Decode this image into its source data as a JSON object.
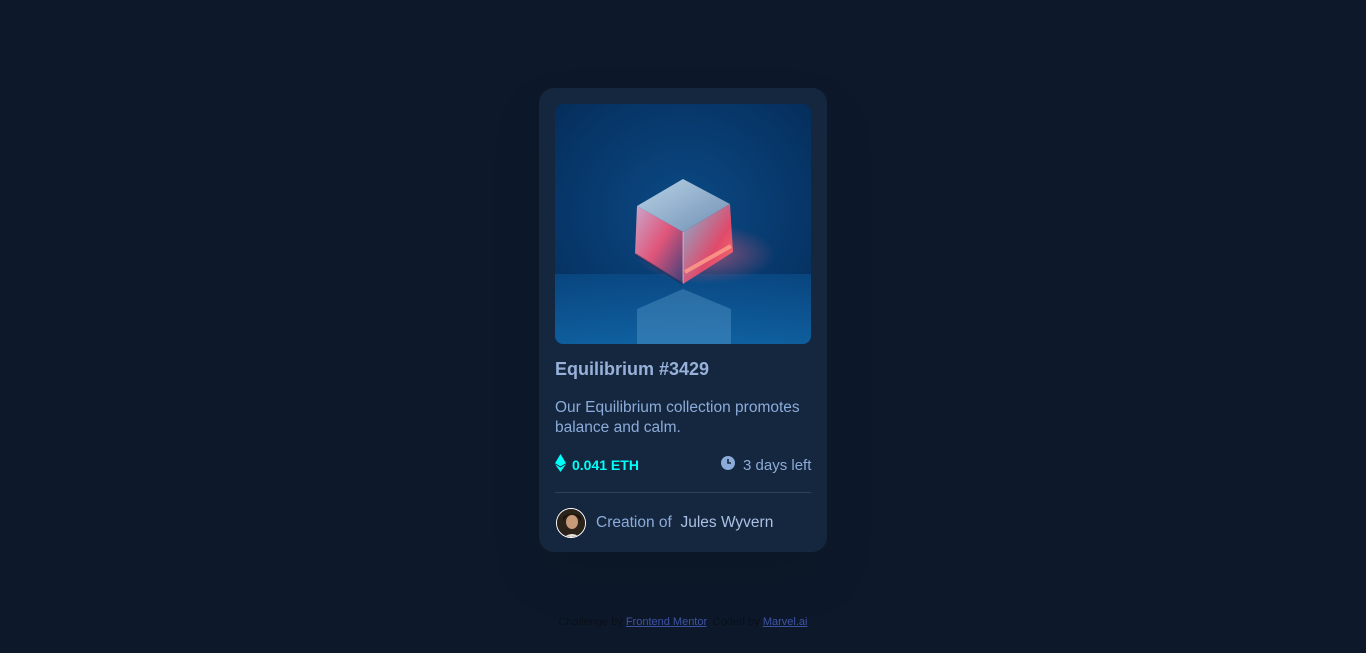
{
  "card": {
    "image_alt": "Equilibrium",
    "title": "Equilibrium #3429",
    "description": "Our Equilibrium collection promotes balance and calm.",
    "price": "0.041 ETH",
    "time_left": "3 days left",
    "creator_prefix": "Creation of",
    "creator_name": "Jules Wyvern",
    "icons": {
      "price": "ethereum-icon",
      "time": "clock-icon"
    }
  },
  "attribution": {
    "prefix": "Challenge by",
    "challenge_link": "Frontend Mentor",
    "middle": ". Coded by",
    "coder_link": "Marvel.ai"
  },
  "colors": {
    "background": "#0d192b",
    "card": "#15263f",
    "title": "#97b1d9",
    "text": "#8bacd9",
    "accent_cyan": "#00fff8",
    "link": "#3e52a3"
  }
}
